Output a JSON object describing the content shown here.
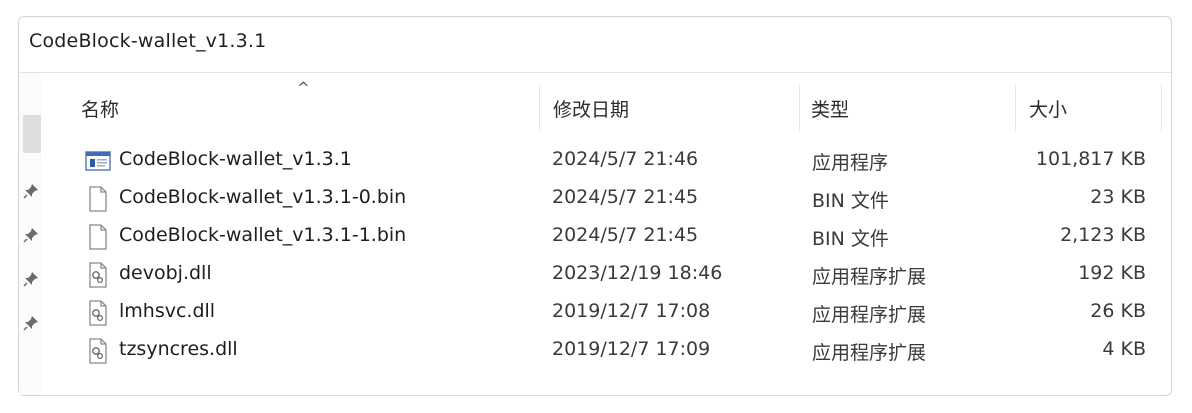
{
  "window": {
    "path": "CodeBlock-wallet_v1.3.1"
  },
  "columns": {
    "name": "名称",
    "date": "修改日期",
    "type": "类型",
    "size": "大小",
    "sort_indicator": "^"
  },
  "files": [
    {
      "name": "CodeBlock-wallet_v1.3.1",
      "date": "2024/5/7 21:46",
      "type": "应用程序",
      "size": "101,817 KB",
      "icon": "application-icon"
    },
    {
      "name": "CodeBlock-wallet_v1.3.1-0.bin",
      "date": "2024/5/7 21:45",
      "type": "BIN 文件",
      "size": "23 KB",
      "icon": "file-icon"
    },
    {
      "name": "CodeBlock-wallet_v1.3.1-1.bin",
      "date": "2024/5/7 21:45",
      "type": "BIN 文件",
      "size": "2,123 KB",
      "icon": "file-icon"
    },
    {
      "name": "devobj.dll",
      "date": "2023/12/19 18:46",
      "type": "应用程序扩展",
      "size": "192 KB",
      "icon": "dll-icon"
    },
    {
      "name": "lmhsvc.dll",
      "date": "2019/12/7 17:08",
      "type": "应用程序扩展",
      "size": "26 KB",
      "icon": "dll-icon"
    },
    {
      "name": "tzsyncres.dll",
      "date": "2019/12/7 17:09",
      "type": "应用程序扩展",
      "size": "4 KB",
      "icon": "dll-icon"
    }
  ],
  "sidebar": {
    "pins": [
      "pin-icon",
      "pin-icon",
      "pin-icon",
      "pin-icon"
    ]
  }
}
